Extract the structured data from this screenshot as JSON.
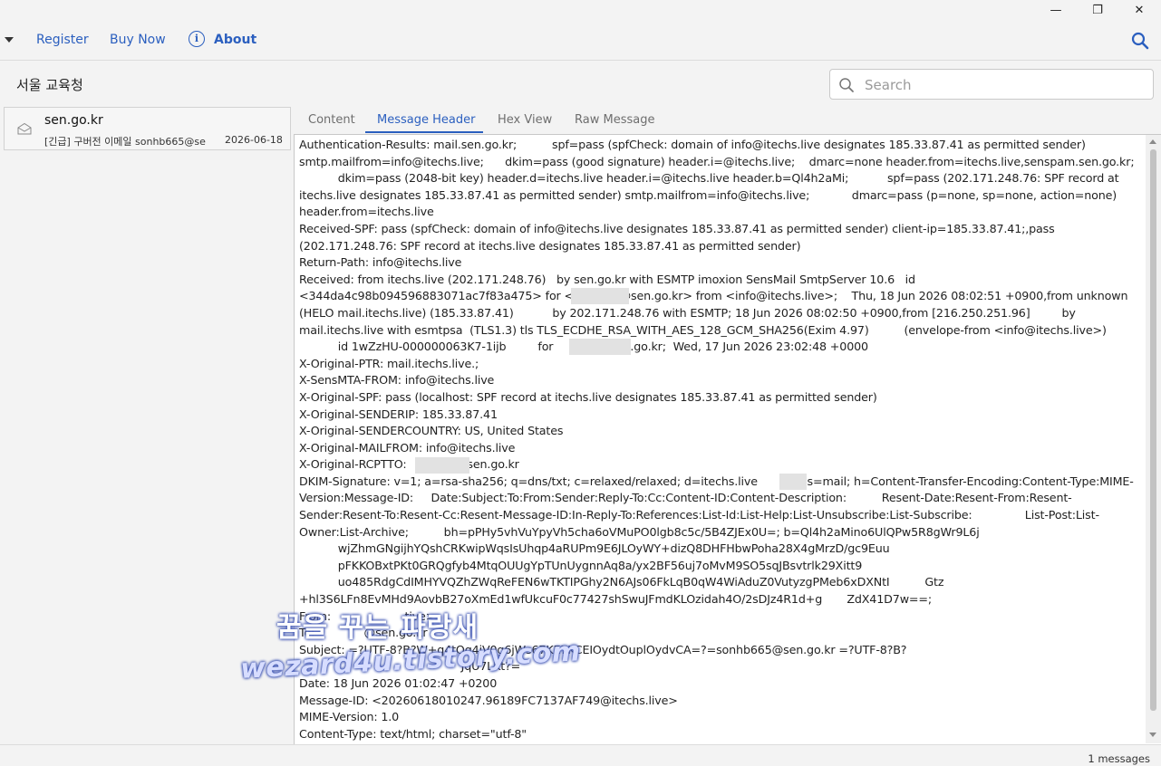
{
  "window": {
    "minimize_glyph": "—",
    "maximize_glyph": "❐",
    "close_glyph": "✕"
  },
  "toolbar": {
    "register_label": "Register",
    "buy_now_label": "Buy Now",
    "about_label": "About",
    "icons": [
      "dropdown-icon",
      "info-icon",
      "search-icon"
    ],
    "accent_color": "#2b5fbf"
  },
  "folder": {
    "title": "서울 교육청"
  },
  "search": {
    "placeholder": "Search"
  },
  "message_list": [
    {
      "sender": "sen.go.kr",
      "subject": "[긴급] 구버전 이메일 sonhb665@se",
      "date": "2026-06-18"
    }
  ],
  "tabs": [
    {
      "label": "Content",
      "active": false
    },
    {
      "label": "Message Header",
      "active": true
    },
    {
      "label": "Hex View",
      "active": false
    },
    {
      "label": "Raw Message",
      "active": false
    }
  ],
  "header_lines": [
    "Authentication-Results: mail.sen.go.kr;          spf=pass (spfCheck: domain of info@itechs.live designates 185.33.87.41 as permitted sender) smtp.mailfrom=info@itechs.live;      dkim=pass (good signature) header.i=@itechs.live;    dmarc=none header.from=itechs.live,senspam.sen.go.kr;",
    "           dkim=pass (2048-bit key) header.d=itechs.live header.i=@itechs.live header.b=Ql4h2aMi;           spf=pass (202.171.248.76: SPF record at itechs.live designates 185.33.87.41 as permitted sender) smtp.mailfrom=info@itechs.live;            dmarc=pass (p=none, sp=none, action=none) header.from=itechs.live",
    "Received-SPF: pass (spfCheck: domain of info@itechs.live designates 185.33.87.41 as permitted sender) client-ip=185.33.87.41;,pass (202.171.248.76: SPF record at itechs.live designates 185.33.87.41 as permitted sender)",
    "Return-Path: info@itechs.live",
    "Received: from itechs.live (202.171.248.76)   by sen.go.kr with ESMTP imoxion SensMail SmtpServer 10.6   id <344da4c98b094596883071ac7f83a475> for <             @sen.go.kr> from <info@itechs.live>;    Thu, 18 Jun 2026 08:02:51 +0900,from unknown (HELO mail.itechs.live) (185.33.87.41)           by 202.171.248.76 with ESMTP; 18 Jun 2026 08:02:50 +0900,from [216.250.251.96]         by mail.itechs.live with esmtpsa  (TLS1.3) tls TLS_ECDHE_RSA_WITH_AES_128_GCM_SHA256(Exim 4.97)          (envelope-from <info@itechs.live>)",
    "           id 1wZzHU-000000063K7-1ijb         for             @sen.go.kr;  Wed, 17 Jun 2026 23:02:48 +0000",
    "X-Original-PTR: mail.itechs.live.;",
    "X-SensMTA-FROM: info@itechs.live",
    "X-Original-SPF: pass (localhost: SPF record at itechs.live designates 185.33.87.41 as permitted sender)",
    "X-Original-SENDERIP: 185.33.87.41",
    "X-Original-SENDERCOUNTRY: US, United States",
    "X-Original-MAILFROM: info@itechs.live",
    "X-Original-RCPTTO:              @sen.go.kr",
    "DKIM-Signature: v=1; a=rsa-sha256; q=dns/txt; c=relaxed/relaxed; d=itechs.live            ; s=mail; h=Content-Transfer-Encoding:Content-Type:MIME-Version:Message-ID:     Date:Subject:To:From:Sender:Reply-To:Cc:Content-ID:Content-Description:          Resent-Date:Resent-From:Resent-Sender:Resent-To:Resent-Cc:Resent-Message-ID:In-Reply-To:References:List-Id:List-Help:List-Unsubscribe:List-Subscribe:               List-Post:List-Owner:List-Archive;          bh=pPHy5vhVuYpyVh5cha6oVMuPO0lgb8c5c/5B4ZJEx0U=; b=Ql4h2aMino6UlQPw5R8gWr9L6j",
    "           wjZhmGNgijhYQshCRKwipWqsIsUhqp4aRUPm9E6JLOyWY+dizQ8DHFHbwPoha28X4gMrzD/gc9Euu",
    "           pFKKOBxtPKt0GRQgfyb4MtqOUUgYpTUnUygnnAq8a/yx2BF56uj7oMvM9SO5sqJBsvtrlk29Xitt9",
    "           uo485RdgCdIMHYVQZhZWqReFEN6wTKTIPGhy2N6AJs06FkLqB0qW4WiAduZ0VutyzgPMeb6xDXNtI          Gtz",
    "+hl3S6LFn8EvMHd9AovbB27oXmEd1wfUkcuF0c77427shSwuJFmdKLOzidah4O/2sDJz4R1d+g       ZdX41D7w==;",
    "From:                     tive>",
    "To:              @sen.go.kr",
    "Subject: =?UTF-8?B?W+q4tOq4iV0g6jWs67KE7KCEIOydtOuplOydvCA=?=sonhb665@sen.go.kr =?UTF-8?B?",
    "                                              JqU7LKt?=",
    "Date: 18 Jun 2026 01:02:47 +0200",
    "Message-ID: <20260618010247.96189FC7137AF749@itechs.live>",
    "MIME-Version: 1.0",
    "Content-Type: text/html; charset=\"utf-8\""
  ],
  "watermark": {
    "line1": "꿈을 꾸는 파랑새",
    "line2": "wezard4u.tistory.com"
  },
  "status": {
    "text": "1 messages"
  }
}
